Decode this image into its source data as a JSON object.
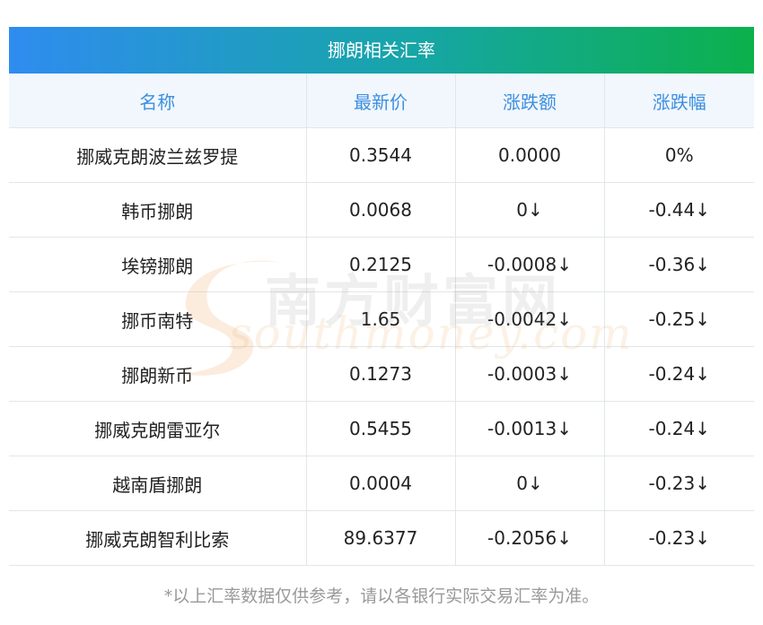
{
  "title": "挪朗相关汇率",
  "columns": [
    "名称",
    "最新价",
    "涨跌额",
    "涨跌幅"
  ],
  "rows": [
    {
      "name": "挪威克朗波兰兹罗提",
      "price": "0.3544",
      "change": "0.0000",
      "pct": "0%"
    },
    {
      "name": "韩币挪朗",
      "price": "0.0068",
      "change": "0↓",
      "pct": "-0.44↓"
    },
    {
      "name": "埃镑挪朗",
      "price": "0.2125",
      "change": "-0.0008↓",
      "pct": "-0.36↓"
    },
    {
      "name": "挪币南特",
      "price": "1.65",
      "change": "-0.0042↓",
      "pct": "-0.25↓"
    },
    {
      "name": "挪朗新币",
      "price": "0.1273",
      "change": "-0.0003↓",
      "pct": "-0.24↓"
    },
    {
      "name": "挪威克朗雷亚尔",
      "price": "0.5455",
      "change": "-0.0013↓",
      "pct": "-0.24↓"
    },
    {
      "name": "越南盾挪朗",
      "price": "0.0004",
      "change": "0↓",
      "pct": "-0.23↓"
    },
    {
      "name": "挪威克朗智利比索",
      "price": "89.6377",
      "change": "-0.2056↓",
      "pct": "-0.23↓"
    }
  ],
  "watermark": {
    "cn": "南方财富网",
    "en": "southmoney.com"
  },
  "footnote": "*以上汇率数据仅供参考，请以各银行实际交易汇率为准。",
  "colors": {
    "title_gradient_start": "#2f8cf0",
    "title_gradient_end": "#0cb14b",
    "header_text": "#3d8fe0",
    "header_bg": "#f1f7fd",
    "down": "#128a12",
    "flat": "#222222",
    "footnote": "#999999"
  }
}
